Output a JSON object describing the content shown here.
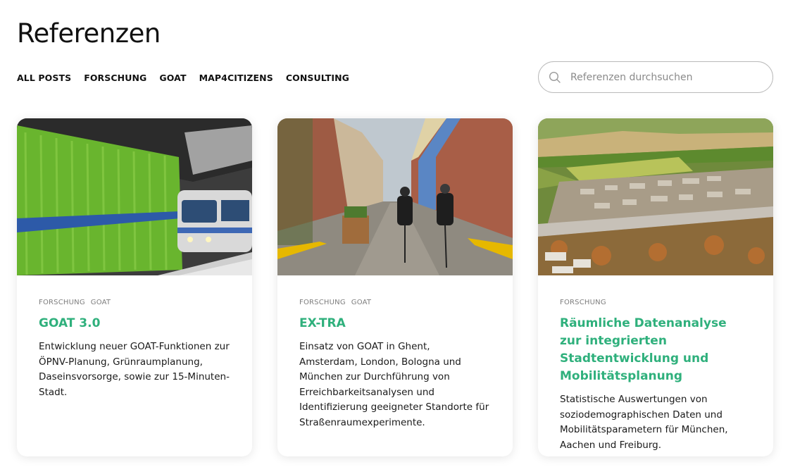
{
  "page": {
    "title": "Referenzen"
  },
  "filters": [
    {
      "label": "ALL POSTS"
    },
    {
      "label": "FORSCHUNG"
    },
    {
      "label": "GOAT"
    },
    {
      "label": "MAP4CITIZENS"
    },
    {
      "label": "CONSULTING"
    }
  ],
  "search": {
    "placeholder": "Referenzen durchsuchen",
    "value": "",
    "icon": "search-icon"
  },
  "colors": {
    "accent": "#2fb07c",
    "text": "#141414",
    "tag": "#7d7d7d"
  },
  "cards": [
    {
      "image": "subway-station-photo",
      "tags": [
        "FORSCHUNG",
        "GOAT"
      ],
      "title": "GOAT 3.0",
      "text": "Entwicklung neuer GOAT-Funktionen zur ÖPNV-Planung, Grünraumplanung, Daseinsvorsorge, sowie zur 15-Minuten-Stadt."
    },
    {
      "image": "street-cyclists-photo",
      "tags": [
        "FORSCHUNG",
        "GOAT"
      ],
      "title": "EX-TRA",
      "text": "Einsatz von GOAT in Ghent, Amsterdam, London, Bologna und München zur Durchführung von Erreichbarkeitsanalysen und Identifizierung geeigneter Standorte für Straßenraumexperimente."
    },
    {
      "image": "aerial-city-photo",
      "tags": [
        "FORSCHUNG"
      ],
      "title": "Räumliche Datenanalyse zur integrierten Stadtentwicklung und Mobilitätsplanung",
      "text": "Statistische Auswertungen von soziodemographischen Daten und Mobilitätsparametern für München, Aachen und Freiburg."
    }
  ]
}
